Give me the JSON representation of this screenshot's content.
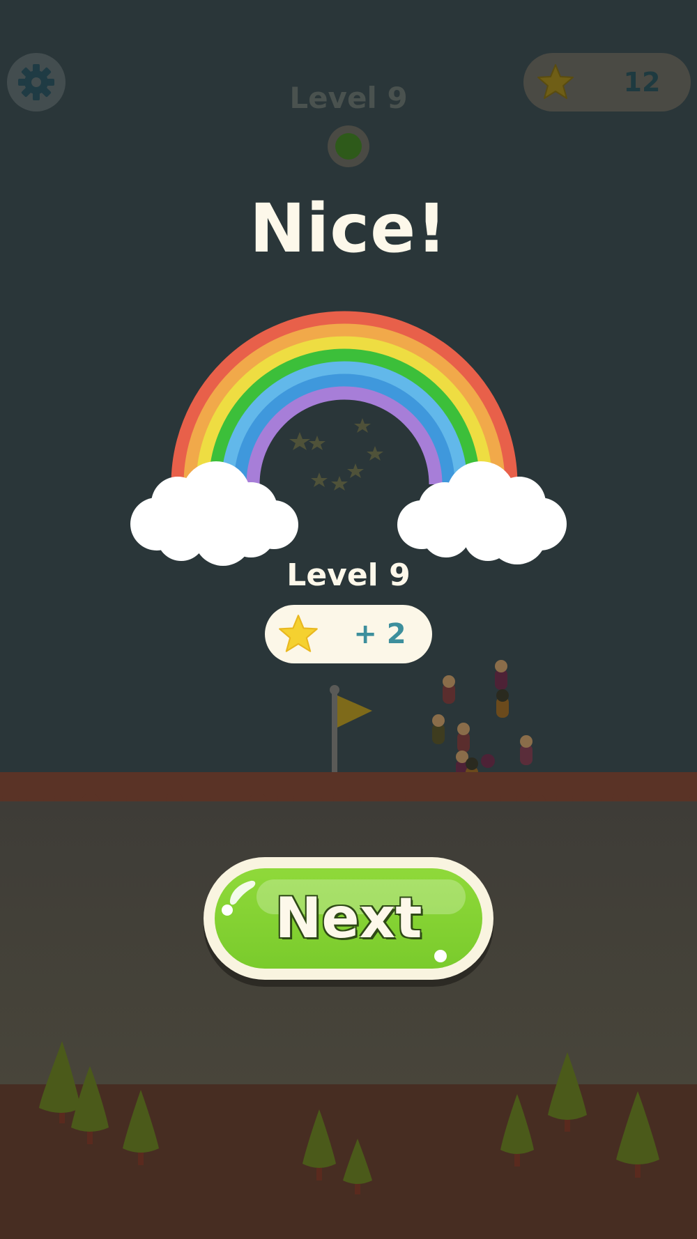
{
  "hud": {
    "settings_icon": "gear-icon",
    "star_icon": "star-icon",
    "star_count": "12",
    "level_title": "Level 9",
    "level_progress": 1
  },
  "result": {
    "headline": "Nice!",
    "level_label": "Level 9",
    "reward_icon": "star-icon",
    "reward_amount": "+ 2"
  },
  "actions": {
    "next_label": "Next"
  },
  "colors": {
    "background": "#2a3639",
    "accent_green": "#8fd93a",
    "star_yellow": "#f5d130",
    "cream": "#fdf8ea",
    "reward_text": "#3d8f9c"
  }
}
